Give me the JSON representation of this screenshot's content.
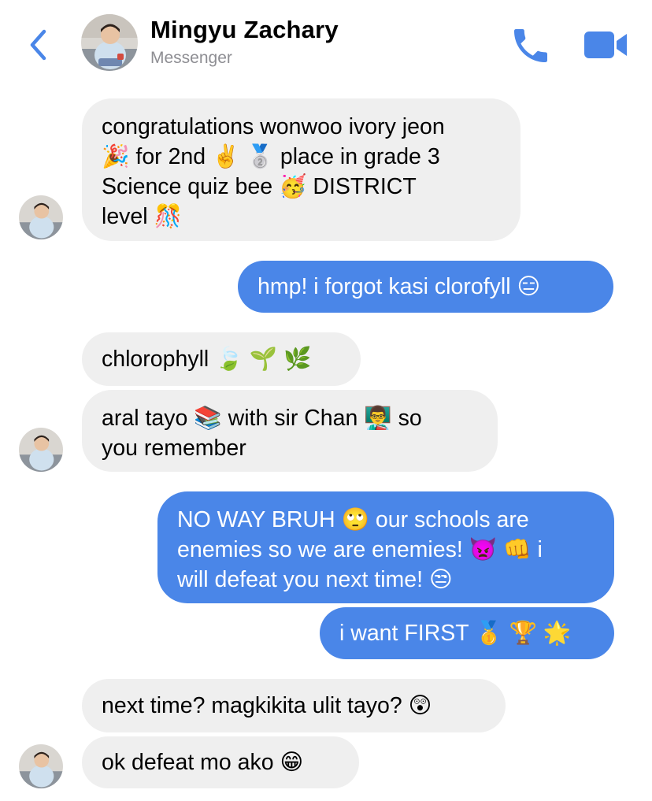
{
  "header": {
    "contact_name": "Mingyu Zachary",
    "contact_subtitle": "Messenger",
    "back_icon": "chevron-left-icon",
    "call_icon": "phone-icon",
    "video_icon": "video-camera-icon",
    "accent_color": "#4a86e8"
  },
  "messages": [
    {
      "direction": "incoming",
      "text": "congratulations wonwoo ivory jeon\n🎉 for 2nd ✌️ 🥈 place in grade 3\nScience quiz bee 🥳 DISTRICT\nlevel 🎊"
    },
    {
      "direction": "outgoing",
      "text": "hmp! i forgot kasi clorofyll 😑"
    },
    {
      "direction": "incoming",
      "text": "chlorophyll 🍃 🌱 🌿"
    },
    {
      "direction": "incoming",
      "text": "aral tayo 📚 with sir Chan 👨‍🏫 so\nyou remember"
    },
    {
      "direction": "outgoing",
      "text": "NO WAY BRUH 🙄 our schools are\nenemies so we are enemies! 👿 👊 i\nwill defeat you next time! 😒"
    },
    {
      "direction": "outgoing",
      "text": "i want FIRST 🥇 🏆 🌟"
    },
    {
      "direction": "incoming",
      "text": "next time? magkikita ulit tayo? 😲"
    },
    {
      "direction": "incoming",
      "text": "ok defeat mo ako 😁"
    }
  ],
  "colors": {
    "incoming_bubble": "#efefef",
    "outgoing_bubble": "#4a86e8",
    "subtitle_gray": "#8e8e93"
  }
}
